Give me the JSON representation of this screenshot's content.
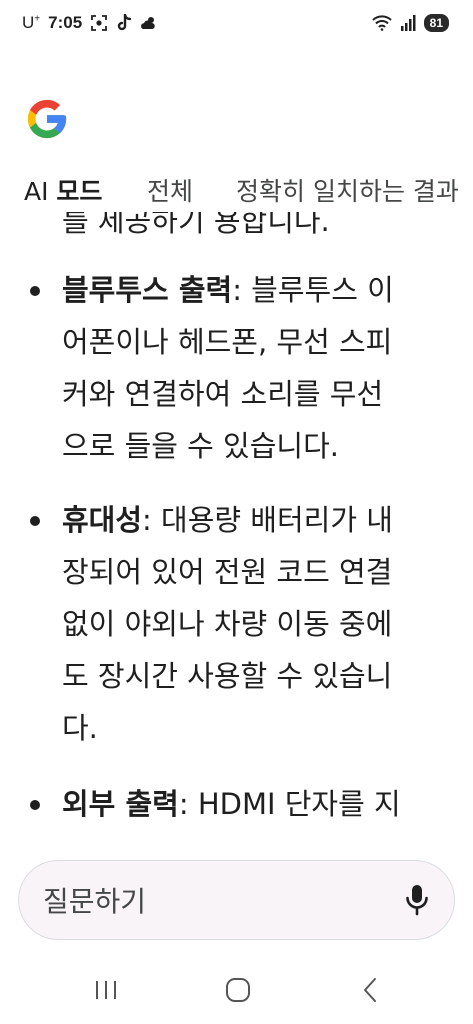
{
  "status_bar": {
    "carrier": "U",
    "carrier_sup": "+",
    "time": "7:05",
    "battery": "81"
  },
  "tabs": [
    {
      "label_prefix": "AI ",
      "label_bold": "모드"
    },
    {
      "label": "전체"
    },
    {
      "label": "정확히 일치하는 결과"
    }
  ],
  "content": {
    "clipped_text": "를 제공하기 용합니다.",
    "items": [
      {
        "term": "블루투스 출력",
        "lines": [
          ": 블루투스 이",
          "어폰이나 헤드폰, 무선 스피",
          "커와 연결하여 소리를 무선",
          "으로 들을 수 있습니다."
        ]
      },
      {
        "term": "휴대성",
        "lines": [
          ": 대용량 배터리가 내",
          "장되어 있어 전원 코드 연결",
          "없이 야외나 차량 이동 중에",
          "도 장시간 사용할 수 있습니",
          "다."
        ]
      },
      {
        "term": "외부 출력",
        "lines": [
          ": HDMI 단자를 지"
        ]
      }
    ]
  },
  "ask_bar": {
    "placeholder": "질문하기"
  },
  "colors": {
    "google_blue": "#4285F4",
    "google_red": "#EA4335",
    "google_yellow": "#FBBC05",
    "google_green": "#34A853",
    "text": "#1f1f1f",
    "ask_bar_bg": "#f8f4f8"
  },
  "icons": {
    "screenshot": "screenshot-icon",
    "tiktok": "tiktok-icon",
    "weather": "weather-icon",
    "wifi": "wifi-icon",
    "signal": "signal-icon",
    "mic": "mic-icon",
    "recents": "recents-icon",
    "home": "home-icon",
    "back": "back-icon"
  }
}
